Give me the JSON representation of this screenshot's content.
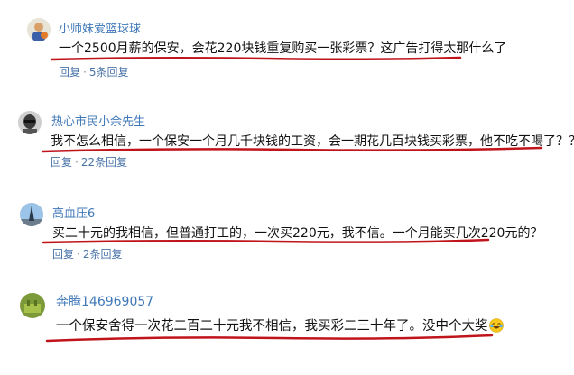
{
  "comments": [
    {
      "username": "小师妹爱篮球球",
      "text": "一个2500月薪的保安，会花220块钱重复购买一张彩票？这广告打得太那什么了",
      "reply": "回复",
      "reply_count": "5条回复"
    },
    {
      "username": "热心市民小余先生",
      "text": "我不怎么相信，一个保安一个月几千块钱的工资，会一期花几百块钱买彩票，他不吃不喝了？？？",
      "reply": "回复",
      "reply_count": "22条回复"
    },
    {
      "username": "高血压6",
      "text": "买二十元的我相信，但普通打工的，一次买220元，我不信。一个月能买几次220元的？",
      "reply": "回复",
      "reply_count": "2条回复"
    },
    {
      "username": "奔腾146969057",
      "text": "一个保安舍得一次花二百二十元我不相信，我买彩二三十年了。没中个大奖",
      "emoji_icon": "laughing-crying-emoji"
    }
  ],
  "colors": {
    "username": "#3f78b8",
    "meta": "#4a74a8",
    "text": "#111111",
    "underline": "#c0141b"
  }
}
